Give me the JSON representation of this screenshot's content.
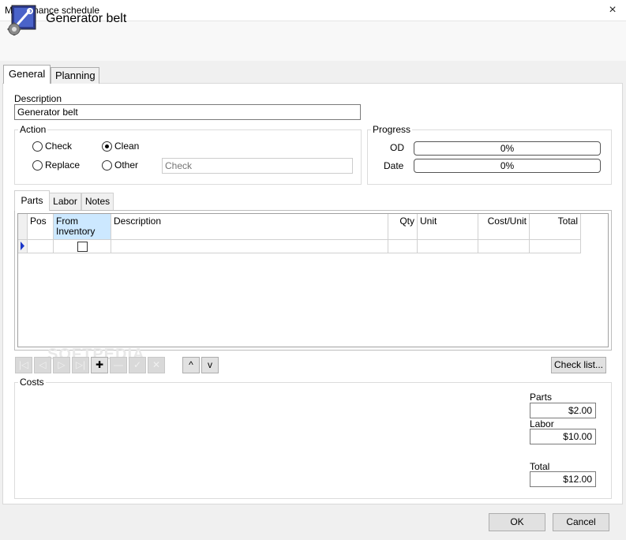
{
  "window": {
    "title": "Maintenance schedule",
    "close_icon": "×"
  },
  "header": {
    "title": "Generator belt",
    "icon": "maintenance-tools-icon"
  },
  "tabs": {
    "general": "General",
    "planning": "Planning"
  },
  "description": {
    "label": "Description",
    "value": "Generator belt"
  },
  "action": {
    "label": "Action",
    "check": "Check",
    "clean": "Clean",
    "replace": "Replace",
    "other": "Other",
    "selected": "Clean",
    "other_placeholder": "Check"
  },
  "progress": {
    "label": "Progress",
    "od_label": "OD",
    "od_value": "0%",
    "date_label": "Date",
    "date_value": "0%"
  },
  "subtabs": {
    "parts": "Parts",
    "labor": "Labor",
    "notes": "Notes"
  },
  "grid": {
    "columns": {
      "pos": "Pos",
      "from_inventory_1": "From",
      "from_inventory_2": "Inventory",
      "description": "Description",
      "qty": "Qty",
      "unit": "Unit",
      "cost_unit": "Cost/Unit",
      "total": "Total"
    }
  },
  "nav": {
    "first": "|◁",
    "prev": "◁",
    "next": "▷",
    "last": "▷|",
    "add": "✚",
    "remove": "—",
    "confirm": "✓",
    "cancel": "✕",
    "up": "^",
    "down": "v"
  },
  "checklist_label": "Check list...",
  "watermark": "SOFTPEDIA",
  "costs": {
    "label": "Costs",
    "parts_label": "Parts",
    "parts_value": "$2.00",
    "labor_label": "Labor",
    "labor_value": "$10.00",
    "total_label": "Total",
    "total_value": "$12.00"
  },
  "buttons": {
    "ok": "OK",
    "cancel": "Cancel"
  }
}
